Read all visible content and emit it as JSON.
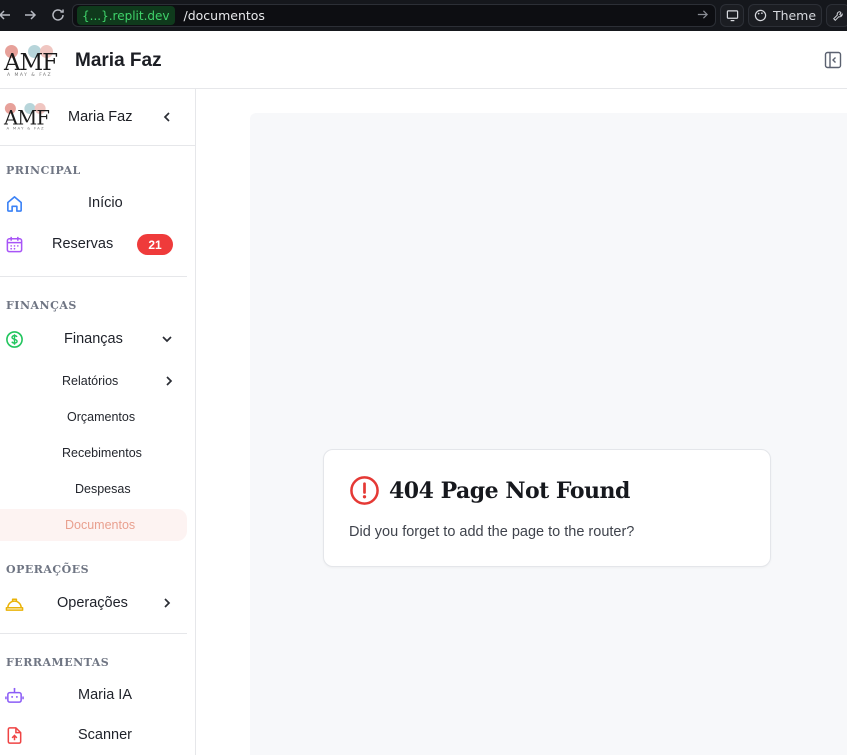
{
  "browser": {
    "domain": "{...}.replit.dev",
    "path": "/documentos",
    "theme_label": "Theme"
  },
  "header": {
    "logo_text": "AMF",
    "logo_tagline": "A MAY & FAZ",
    "brand": "Maria Faz"
  },
  "sidebar": {
    "brand": "Maria Faz",
    "sections": {
      "principal": "PRINCIPAL",
      "financas": "FINANÇAS",
      "operacoes": "OPERAÇÕES",
      "ferramentas": "FERRAMENTAS"
    },
    "items": {
      "inicio": "Início",
      "reservas": "Reservas",
      "reservas_count": "21",
      "financas": "Finanças",
      "relatorios": "Relatórios",
      "orcamentos": "Orçamentos",
      "recebimentos": "Recebimentos",
      "despesas": "Despesas",
      "documentos": "Documentos",
      "operacoes": "Operações",
      "maria_ia": "Maria IA",
      "scanner": "Scanner"
    }
  },
  "main": {
    "error_title": "404 Page Not Found",
    "error_message": "Did you forget to add the page to the router?"
  },
  "colors": {
    "accent": "#e9a08f",
    "badge": "#ef3b3b",
    "error": "#e53935",
    "domain_green": "#3fd26a"
  }
}
